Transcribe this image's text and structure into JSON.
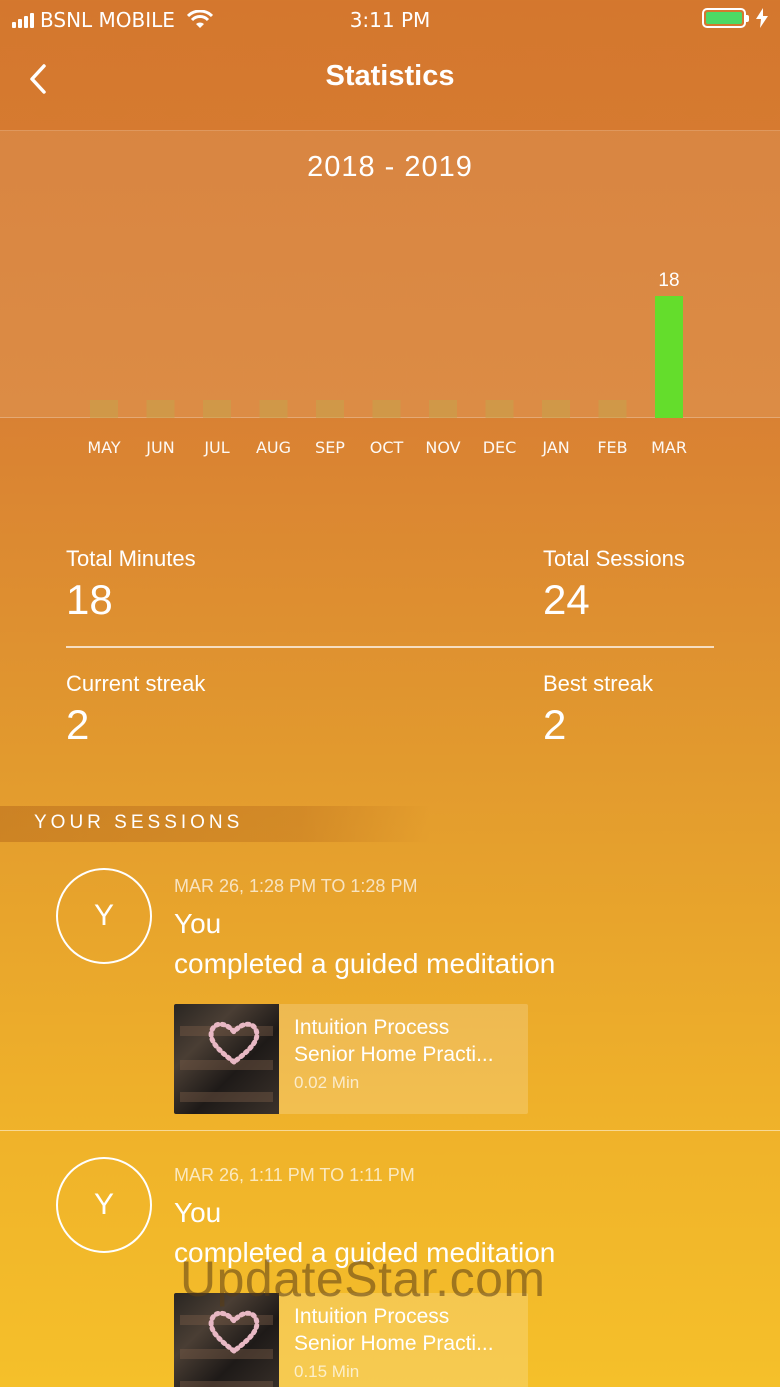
{
  "status_bar": {
    "carrier": "BSNL MOBILE",
    "time": "3:11 PM",
    "battery_color": "#4cd964"
  },
  "nav": {
    "title": "Statistics",
    "back_icon": "chevron-left-icon"
  },
  "chart_data": {
    "type": "bar",
    "title": "2018 - 2019",
    "categories": [
      "MAY",
      "JUN",
      "JUL",
      "AUG",
      "SEP",
      "OCT",
      "NOV",
      "DEC",
      "JAN",
      "FEB",
      "MAR"
    ],
    "values": [
      0,
      0,
      0,
      0,
      0,
      0,
      0,
      0,
      0,
      0,
      18
    ],
    "data_labels": [
      "",
      "",
      "",
      "",
      "",
      "",
      "",
      "",
      "",
      "",
      "18"
    ],
    "bar_color": "#64dd2c",
    "empty_bar_color": "#c7a24a",
    "ylim": [
      0,
      18
    ],
    "grid": false
  },
  "stats": {
    "total_minutes_label": "Total Minutes",
    "total_minutes_value": "18",
    "total_sessions_label": "Total Sessions",
    "total_sessions_value": "24",
    "current_streak_label": "Current streak",
    "current_streak_value": "2",
    "best_streak_label": "Best streak",
    "best_streak_value": "2"
  },
  "sessions": {
    "header": "YOUR SESSIONS",
    "items": [
      {
        "avatar": "Y",
        "time": "MAR 26, 1:28 PM TO 1:28 PM",
        "who": "You",
        "action": "completed a guided meditation",
        "card_title": "Intuition Process",
        "card_subtitle": "Senior Home Practi...",
        "card_duration": "0.02 Min"
      },
      {
        "avatar": "Y",
        "time": "MAR 26, 1:11 PM TO 1:11 PM",
        "who": "You",
        "action": "completed a guided meditation",
        "card_title": "Intuition Process",
        "card_subtitle": "Senior Home Practi...",
        "card_duration": "0.15 Min"
      }
    ]
  },
  "watermark": "UpdateStar.com"
}
